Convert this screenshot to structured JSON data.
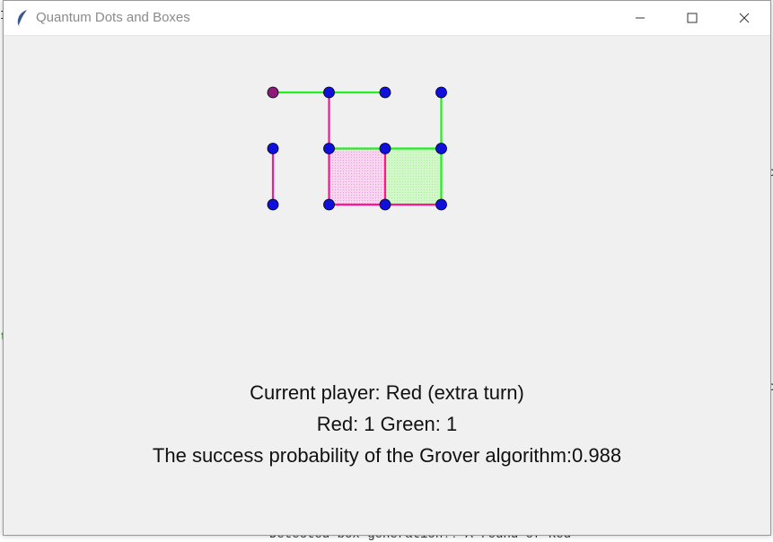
{
  "window": {
    "title": "Quantum Dots and Boxes",
    "controls": [
      "minimize",
      "maximize",
      "close"
    ]
  },
  "background_fragments": [
    "I",
    "t",
    "c",
    "c",
    "Detected  box generation!! A round of Red"
  ],
  "colors": {
    "red_player": "#ff1493",
    "green_player": "#22ee22",
    "red_box_fill": "#f6c7ea",
    "green_box_fill": "#ccf7c2",
    "dot": "#1010dd",
    "dot_selected": "#8b1a7a"
  },
  "board": {
    "rows": 3,
    "cols": 4,
    "selected_dot": [
      0,
      0
    ],
    "lines": [
      {
        "from": [
          0,
          0
        ],
        "to": [
          0,
          1
        ],
        "player": "green"
      },
      {
        "from": [
          0,
          1
        ],
        "to": [
          0,
          2
        ],
        "player": "green"
      },
      {
        "from": [
          1,
          1
        ],
        "to": [
          1,
          2
        ],
        "player": "green"
      },
      {
        "from": [
          1,
          2
        ],
        "to": [
          1,
          3
        ],
        "player": "green"
      },
      {
        "from": [
          0,
          3
        ],
        "to": [
          1,
          3
        ],
        "player": "green"
      },
      {
        "from": [
          1,
          3
        ],
        "to": [
          2,
          3
        ],
        "player": "green"
      },
      {
        "from": [
          0,
          1
        ],
        "to": [
          1,
          1
        ],
        "player": "red"
      },
      {
        "from": [
          1,
          1
        ],
        "to": [
          2,
          1
        ],
        "player": "red"
      },
      {
        "from": [
          1,
          0
        ],
        "to": [
          2,
          0
        ],
        "player": "red"
      },
      {
        "from": [
          1,
          2
        ],
        "to": [
          2,
          2
        ],
        "player": "red"
      },
      {
        "from": [
          2,
          1
        ],
        "to": [
          2,
          2
        ],
        "player": "red"
      },
      {
        "from": [
          2,
          2
        ],
        "to": [
          2,
          3
        ],
        "player": "red"
      }
    ],
    "boxes": [
      {
        "cell": [
          1,
          1
        ],
        "owner": "red"
      },
      {
        "cell": [
          1,
          2
        ],
        "owner": "green"
      }
    ]
  },
  "status": {
    "current_player": "Current player: Red (extra turn)",
    "score": "Red: 1 Green: 1",
    "probability": "The success probability of the Grover algorithm:0.988"
  }
}
